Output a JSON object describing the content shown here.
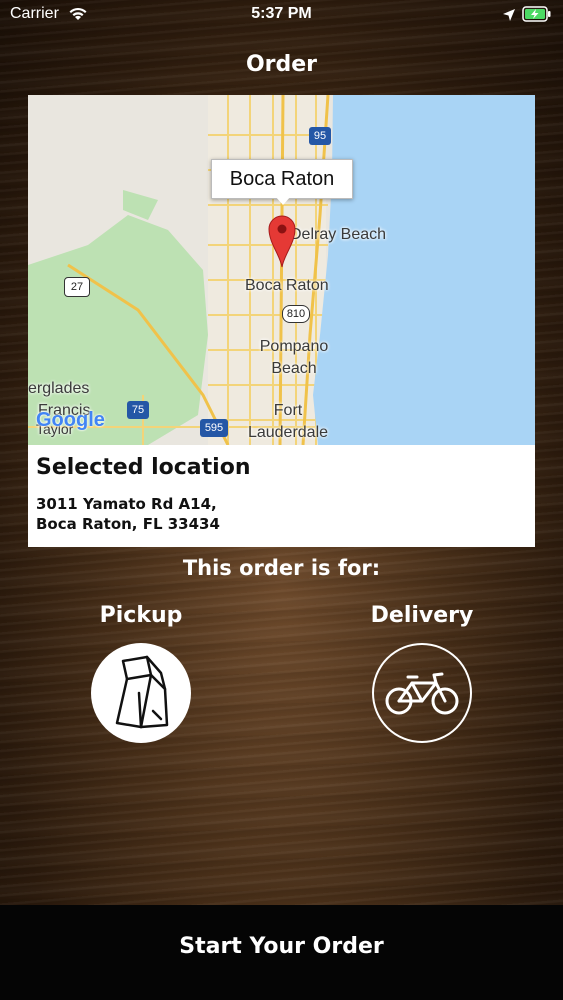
{
  "status_bar": {
    "carrier": "Carrier",
    "time": "5:37 PM"
  },
  "page": {
    "title": "Order"
  },
  "map": {
    "callout": "Boca Raton",
    "labels": {
      "delray": "Delray Beach",
      "boca": "Boca Raton",
      "pompano_1": "Pompano",
      "pompano_2": "Beach",
      "fort_1": "Fort",
      "fort_2": "Lauderdale",
      "everglades": "erglades",
      "francis": "Francis",
      "taylor": "Taylor"
    },
    "shields": {
      "i95": "95",
      "us27": "27",
      "sr810": "810",
      "i75": "75",
      "i595": "595"
    },
    "attribution": "Google",
    "colors": {
      "water": "#a9d4f5",
      "land": "#e9e6df",
      "park": "#bde1b3",
      "roads": "#f6d878"
    }
  },
  "location": {
    "heading": "Selected location",
    "address_line_1": "3011 Yamato Rd A14,",
    "address_line_2": "Boca Raton, FL 33434"
  },
  "order_type": {
    "prompt": "This order is for:",
    "pickup_label": "Pickup",
    "delivery_label": "Delivery"
  },
  "footer": {
    "start_label": "Start Your Order"
  }
}
